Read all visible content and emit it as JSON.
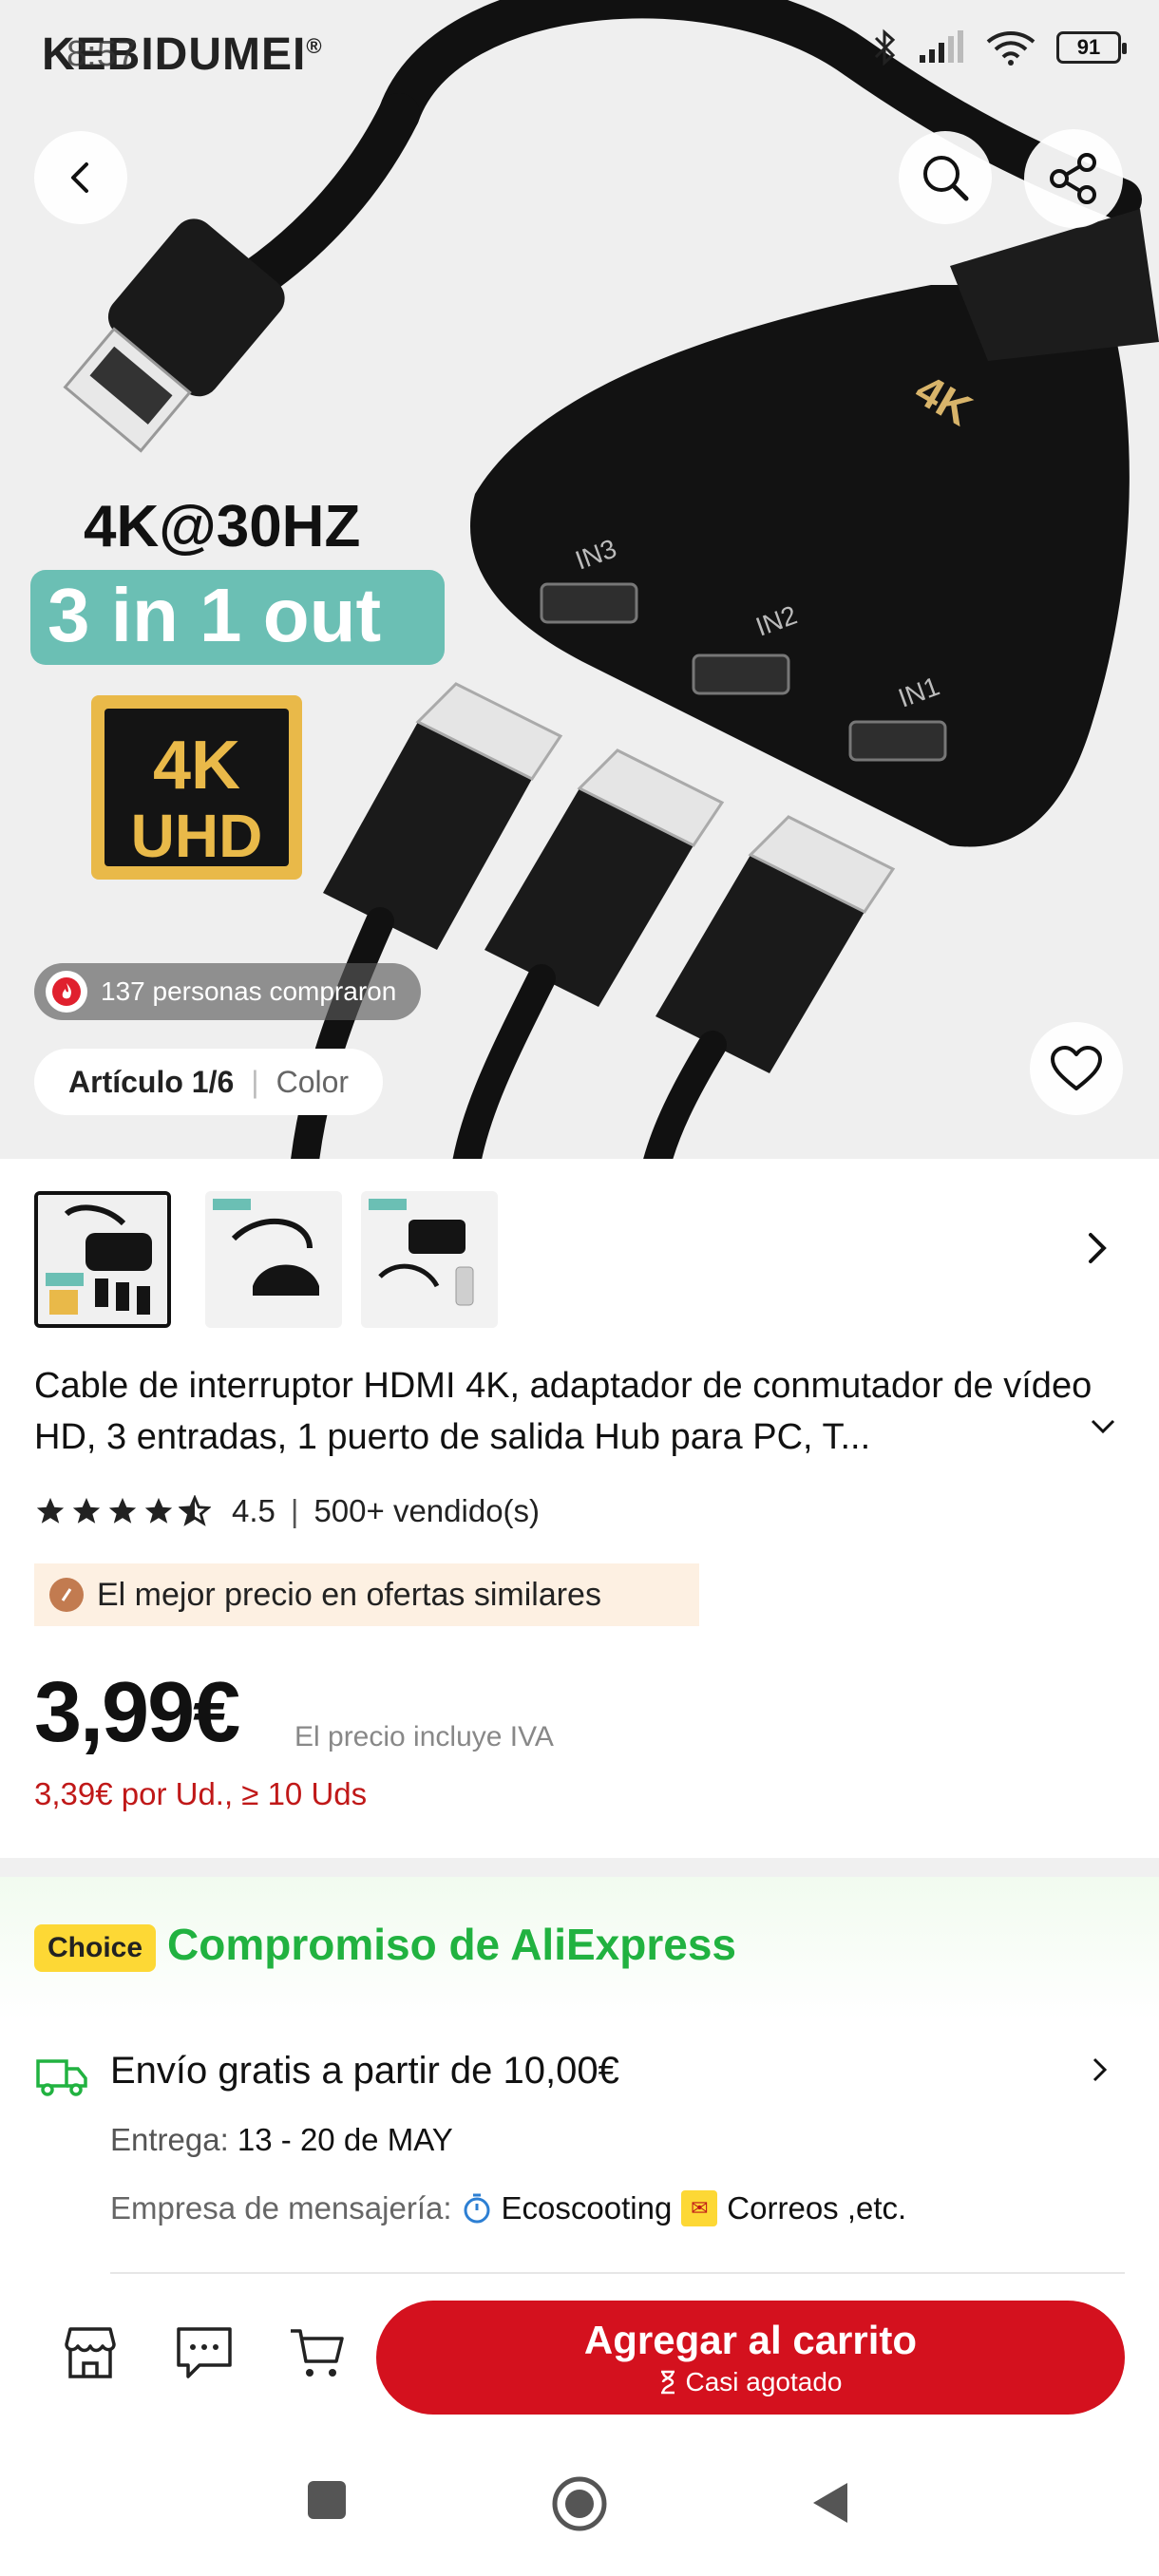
{
  "status_bar": {
    "brand": "KEBIDUMEI",
    "brand_mark": "®",
    "time": "8:57",
    "battery": "91"
  },
  "hero": {
    "badge_4k": "4K@30HZ",
    "badge_io": "3 in 1 out",
    "badge_uhd_top": "4K",
    "badge_uhd_bottom": "UHD",
    "buyers": "137 personas compraron",
    "article_index": "Artículo 1/6",
    "article_attr": "Color"
  },
  "product": {
    "title": "Cable de interruptor HDMI 4K, adaptador de conmutador de vídeo HD, 3 entradas, 1 puerto de salida Hub para PC, T...",
    "rating": "4.5",
    "sold": "500+ vendido(s)",
    "best_price": "El mejor precio en ofertas similares",
    "price": "3,99€",
    "vat_note": "El precio incluye IVA",
    "bulk_price": "3,39€ por Ud., ≥ 10 Uds"
  },
  "choice": {
    "badge": "Choice",
    "title": "Compromiso de AliExpress"
  },
  "shipping": {
    "title": "Envío gratis a partir de 10,00€",
    "delivery_label": "Entrega:",
    "delivery_dates": "13 - 20 de MAY",
    "courier_label": "Empresa de mensajería:",
    "courier_1": "Ecoscooting",
    "courier_2": "Correos ,etc."
  },
  "actions": {
    "add_to_cart": "Agregar al carrito",
    "stock_note": "Casi agotado"
  },
  "colors": {
    "accent_red": "#d4111e",
    "choice_green": "#21b240",
    "choice_yellow": "#fdd835",
    "best_price_bg": "#fdf0e2"
  }
}
